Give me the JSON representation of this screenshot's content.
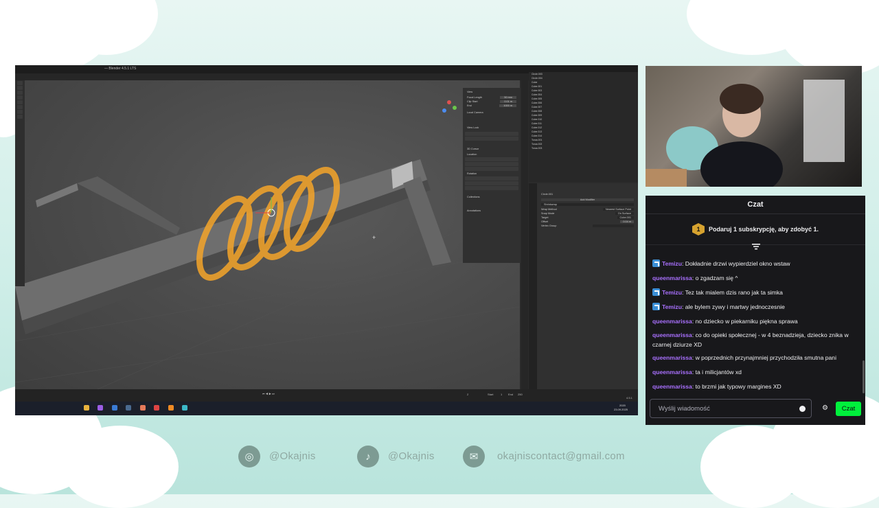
{
  "blender": {
    "title": "— Blender 4.5.1 LTS",
    "workspace_tabs": [
      "Layout",
      "Modeling",
      "Sculpting",
      "UV Editing",
      "Texture Paint",
      "Shading",
      "Animation",
      "Rendering",
      "Compositing",
      "Geometry Nodes",
      "Scripting"
    ],
    "menu_items": [
      "File",
      "Edit",
      "Render",
      "Window",
      "Help"
    ],
    "viewport_menu": [
      "View",
      "Select",
      "Add",
      "Object",
      "Shape",
      "Edge",
      "Face",
      "UV"
    ],
    "view_panel": {
      "header": "View",
      "focal_length_label": "Focal Length",
      "focal_length": "50 mm",
      "clip_start_label": "Clip Start",
      "clip_start": "0.01 m",
      "clip_end_label": "End",
      "clip_end": "1000 m",
      "local_camera_label": "Local Camera",
      "view_lock_header": "View Lock",
      "cursor_header": "3D Cursor",
      "location_label": "Location",
      "rotation_label": "Rotation",
      "collections_header": "Collections",
      "annotations_header": "Annotations"
    },
    "outliner_items": [
      "Circle.003",
      "Circle.004",
      "Cube",
      "Cube.001",
      "Cube.003",
      "Cube.004",
      "Cube.005",
      "Cube.006",
      "Cube.007",
      "Cube.008",
      "Cube.009",
      "Cube.010",
      "Cube.011",
      "Cube.012",
      "Cube.013",
      "Cube.014",
      "Torus.001",
      "Torus.002",
      "Torus.003"
    ],
    "properties": {
      "object_name": "Circle.001",
      "modifier_name": "Shrinkwrap",
      "add_modifier": "Add Modifier",
      "wrap_method_label": "Wrap Method",
      "wrap_method": "Nearest Surface Point",
      "snap_mode_label": "Snap Mode",
      "snap_mode": "On Surface",
      "target_label": "Target",
      "target": "Cube.001",
      "offset_label": "Offset",
      "offset": "0.04 m",
      "vertex_group_label": "Vertex Group"
    },
    "timeline": {
      "start_label": "Start",
      "start": "1",
      "end_label": "End",
      "end": "250",
      "current": "2"
    },
    "version": "4.5.1",
    "clock_time": "2020",
    "clock_date": "23.09.2025"
  },
  "chat": {
    "header": "Czat",
    "sub_banner_count": "1",
    "sub_banner_text": "Podaruj 1 subskrypcję, aby zdobyć 1.",
    "messages": [
      {
        "user": "Temizu",
        "text": ": Dokładnie drzwi wypierdziel okno wstaw",
        "badge": true
      },
      {
        "user": "queenmarissa",
        "text": ": o zgadzam się ^",
        "badge": false
      },
      {
        "user": "Temizu",
        "text": ": Tez tak mialem dzis rano jak ta simka",
        "badge": true
      },
      {
        "user": "Temizu",
        "text": ": ale bylem zywy i martwy jednoczesnie",
        "badge": true
      },
      {
        "user": "queenmarissa",
        "text": ": no dziecko w piekarniku piękna sprawa",
        "badge": false
      },
      {
        "user": "queenmarissa",
        "text": ": co do opieki społecznej - w 4 beznadzieja, dziecko znika w czarnej dziurze XD",
        "badge": false
      },
      {
        "user": "queenmarissa",
        "text": ": w poprzednich przynajmniej przychodziła smutna pani",
        "badge": false
      },
      {
        "user": "queenmarissa",
        "text": ": ta i milicjantów xd",
        "badge": false
      },
      {
        "user": "queenmarissa",
        "text": ": to brzmi jak typowy margines XD",
        "badge": false
      }
    ],
    "input_placeholder": "Wyślij wiadomość",
    "send_label": "Czat"
  },
  "socials": {
    "instagram": "@Okajnis",
    "tiktok": "@Okajnis",
    "email": "okajniscontact@gmail.com"
  },
  "colors": {
    "accent_send": "#00f03c",
    "username": "#a970ff",
    "selection_orange": "#f5a52a"
  }
}
